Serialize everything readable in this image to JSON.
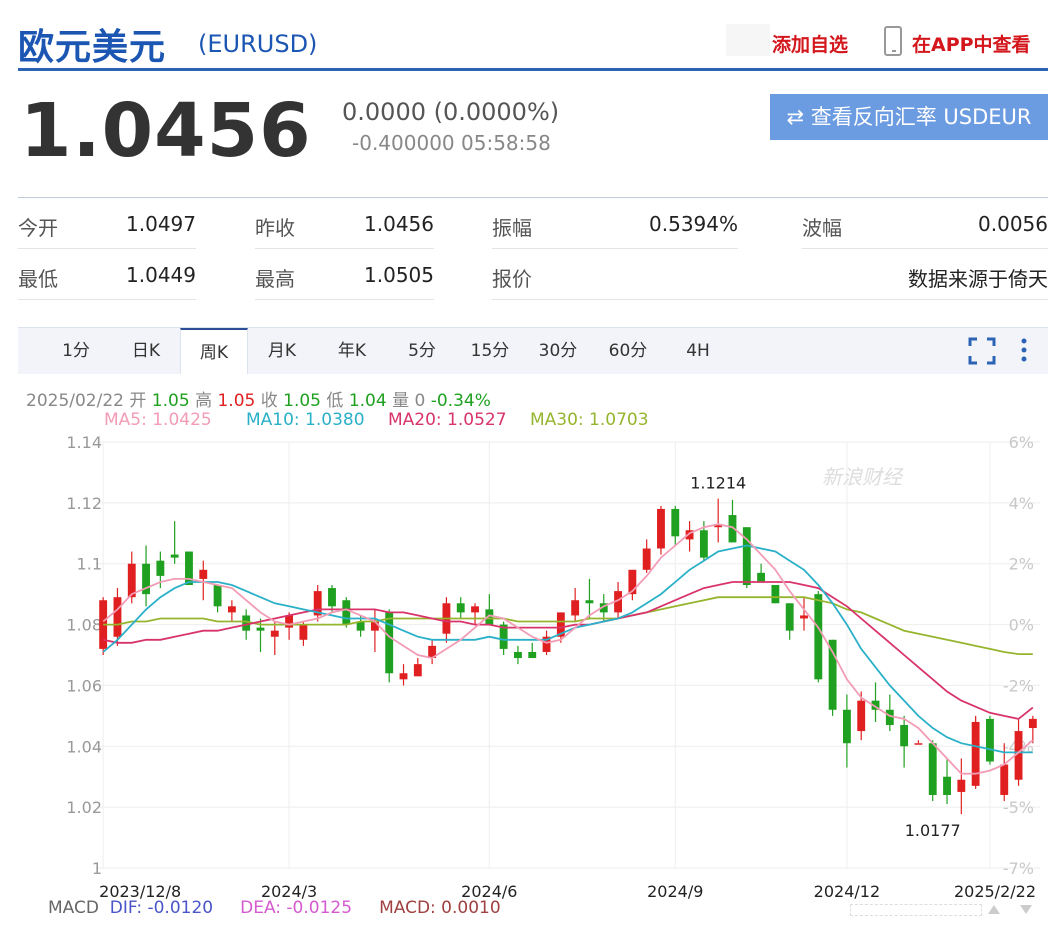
{
  "header": {
    "title": "欧元美元",
    "code": "(EURUSD)",
    "add_watchlist": "添加自选",
    "view_in_app": "在APP中查看"
  },
  "quote": {
    "price": "1.0456",
    "change": "0.0000 (0.0000%)",
    "sub": "-0.400000 05:58:58",
    "reverse_button": "⇄ 查看反向汇率 USDEUR"
  },
  "stats": {
    "open_label": "今开",
    "open": "1.0497",
    "prev_label": "昨收",
    "prev": "1.0456",
    "amp_label": "振幅",
    "amp": "0.5394%",
    "wave_label": "波幅",
    "wave": "0.0056",
    "low_label": "最低",
    "low": "1.0449",
    "high_label": "最高",
    "high": "1.0505",
    "quote_label": "报价",
    "source": "数据来源于倚天"
  },
  "tabs": [
    "1分",
    "日K",
    "周K",
    "月K",
    "年K",
    "5分",
    "15分",
    "30分",
    "60分",
    "4H"
  ],
  "active_tab": "周K",
  "info": {
    "date": "2025/02/22",
    "open_label": "开",
    "open": "1.05",
    "high_label": "高",
    "high": "1.05",
    "close_label": "收",
    "close": "1.05",
    "low_label": "低",
    "low": "1.04",
    "vol_label": "量",
    "vol": "0",
    "pct": "-0.34%",
    "ma5": "MA5: 1.0425",
    "ma10": "MA10: 1.0380",
    "ma20": "MA20: 1.0527",
    "ma30": "MA30: 1.0703"
  },
  "macd": {
    "label": "MACD",
    "dif": "DIF: -0.0120",
    "dea": "DEA: -0.0125",
    "macd": "MACD: 0.0010"
  },
  "watermark": "新浪财经",
  "colors": {
    "up": "#e02020",
    "down": "#20a020",
    "ma5": "#f29cb5",
    "ma10": "#2ab0c8",
    "ma20": "#d8336a",
    "ma30": "#96b52e",
    "brand": "#1b56b3",
    "accent_red": "#d4171d"
  },
  "chart_data": {
    "type": "candlestick",
    "y_ticks": [
      "1.14",
      "1.12",
      "1.1",
      "1.08",
      "1.06",
      "1.04",
      "1.02",
      "1"
    ],
    "y_values": [
      1.14,
      1.12,
      1.1,
      1.08,
      1.06,
      1.04,
      1.02,
      1.0
    ],
    "pct_ticks": [
      "6%",
      "4%",
      "2%",
      "0%",
      "-2%",
      "-4%",
      "-5%",
      "-7%"
    ],
    "x_labels": [
      "2023/12/8",
      "2024/3",
      "2024/6",
      "2024/9",
      "2024/12",
      "2025/2/22"
    ],
    "x_label_index": [
      0,
      13,
      27,
      40,
      52,
      62
    ],
    "ylim": [
      1.0,
      1.14
    ],
    "annotations": [
      {
        "label": "1.1214",
        "index": 43,
        "value": 1.1214
      },
      {
        "label": "1.0177",
        "index": 58,
        "value": 1.0177
      }
    ],
    "candles": [
      {
        "o": 1.072,
        "h": 1.089,
        "l": 1.07,
        "c": 1.088
      },
      {
        "o": 1.076,
        "h": 1.092,
        "l": 1.073,
        "c": 1.089
      },
      {
        "o": 1.089,
        "h": 1.104,
        "l": 1.087,
        "c": 1.1
      },
      {
        "o": 1.1,
        "h": 1.106,
        "l": 1.086,
        "c": 1.09
      },
      {
        "o": 1.101,
        "h": 1.104,
        "l": 1.092,
        "c": 1.096
      },
      {
        "o": 1.103,
        "h": 1.114,
        "l": 1.1,
        "c": 1.102
      },
      {
        "o": 1.104,
        "h": 1.104,
        "l": 1.093,
        "c": 1.093
      },
      {
        "o": 1.095,
        "h": 1.101,
        "l": 1.088,
        "c": 1.098
      },
      {
        "o": 1.093,
        "h": 1.093,
        "l": 1.084,
        "c": 1.086
      },
      {
        "o": 1.084,
        "h": 1.088,
        "l": 1.081,
        "c": 1.086
      },
      {
        "o": 1.083,
        "h": 1.085,
        "l": 1.075,
        "c": 1.078
      },
      {
        "o": 1.079,
        "h": 1.082,
        "l": 1.071,
        "c": 1.078
      },
      {
        "o": 1.076,
        "h": 1.081,
        "l": 1.07,
        "c": 1.078
      },
      {
        "o": 1.079,
        "h": 1.084,
        "l": 1.075,
        "c": 1.083
      },
      {
        "o": 1.075,
        "h": 1.081,
        "l": 1.073,
        "c": 1.08
      },
      {
        "o": 1.083,
        "h": 1.093,
        "l": 1.081,
        "c": 1.091
      },
      {
        "o": 1.092,
        "h": 1.093,
        "l": 1.084,
        "c": 1.086
      },
      {
        "o": 1.088,
        "h": 1.089,
        "l": 1.079,
        "c": 1.08
      },
      {
        "o": 1.081,
        "h": 1.083,
        "l": 1.076,
        "c": 1.078
      },
      {
        "o": 1.078,
        "h": 1.085,
        "l": 1.071,
        "c": 1.081
      },
      {
        "o": 1.084,
        "h": 1.085,
        "l": 1.061,
        "c": 1.064
      },
      {
        "o": 1.062,
        "h": 1.067,
        "l": 1.06,
        "c": 1.064
      },
      {
        "o": 1.063,
        "h": 1.069,
        "l": 1.063,
        "c": 1.067
      },
      {
        "o": 1.069,
        "h": 1.075,
        "l": 1.067,
        "c": 1.073
      },
      {
        "o": 1.077,
        "h": 1.089,
        "l": 1.074,
        "c": 1.087
      },
      {
        "o": 1.087,
        "h": 1.089,
        "l": 1.082,
        "c": 1.084
      },
      {
        "o": 1.084,
        "h": 1.087,
        "l": 1.08,
        "c": 1.086
      },
      {
        "o": 1.085,
        "h": 1.09,
        "l": 1.082,
        "c": 1.08
      },
      {
        "o": 1.08,
        "h": 1.081,
        "l": 1.07,
        "c": 1.072
      },
      {
        "o": 1.071,
        "h": 1.073,
        "l": 1.067,
        "c": 1.069
      },
      {
        "o": 1.071,
        "h": 1.074,
        "l": 1.069,
        "c": 1.069
      },
      {
        "o": 1.071,
        "h": 1.078,
        "l": 1.07,
        "c": 1.076
      },
      {
        "o": 1.076,
        "h": 1.081,
        "l": 1.074,
        "c": 1.084
      },
      {
        "o": 1.083,
        "h": 1.092,
        "l": 1.081,
        "c": 1.088
      },
      {
        "o": 1.088,
        "h": 1.095,
        "l": 1.082,
        "c": 1.087
      },
      {
        "o": 1.087,
        "h": 1.09,
        "l": 1.081,
        "c": 1.084
      },
      {
        "o": 1.084,
        "h": 1.094,
        "l": 1.082,
        "c": 1.091
      },
      {
        "o": 1.09,
        "h": 1.098,
        "l": 1.088,
        "c": 1.098
      },
      {
        "o": 1.098,
        "h": 1.108,
        "l": 1.097,
        "c": 1.105
      },
      {
        "o": 1.105,
        "h": 1.119,
        "l": 1.103,
        "c": 1.118
      },
      {
        "o": 1.118,
        "h": 1.119,
        "l": 1.106,
        "c": 1.109
      },
      {
        "o": 1.108,
        "h": 1.114,
        "l": 1.104,
        "c": 1.111
      },
      {
        "o": 1.111,
        "h": 1.114,
        "l": 1.101,
        "c": 1.102
      },
      {
        "o": 1.112,
        "h": 1.1214,
        "l": 1.107,
        "c": 1.113
      },
      {
        "o": 1.116,
        "h": 1.121,
        "l": 1.107,
        "c": 1.107
      },
      {
        "o": 1.112,
        "h": 1.112,
        "l": 1.092,
        "c": 1.093
      },
      {
        "o": 1.097,
        "h": 1.1,
        "l": 1.094,
        "c": 1.094
      },
      {
        "o": 1.093,
        "h": 1.093,
        "l": 1.087,
        "c": 1.087
      },
      {
        "o": 1.087,
        "h": 1.087,
        "l": 1.075,
        "c": 1.078
      },
      {
        "o": 1.082,
        "h": 1.089,
        "l": 1.078,
        "c": 1.083
      },
      {
        "o": 1.09,
        "h": 1.091,
        "l": 1.061,
        "c": 1.062
      },
      {
        "o": 1.075,
        "h": 1.075,
        "l": 1.05,
        "c": 1.052
      },
      {
        "o": 1.052,
        "h": 1.057,
        "l": 1.033,
        "c": 1.041
      },
      {
        "o": 1.045,
        "h": 1.058,
        "l": 1.042,
        "c": 1.055
      },
      {
        "o": 1.055,
        "h": 1.061,
        "l": 1.048,
        "c": 1.052
      },
      {
        "o": 1.052,
        "h": 1.057,
        "l": 1.045,
        "c": 1.047
      },
      {
        "o": 1.047,
        "h": 1.05,
        "l": 1.033,
        "c": 1.04
      },
      {
        "o": 1.041,
        "h": 1.042,
        "l": 1.041,
        "c": 1.041
      },
      {
        "o": 1.041,
        "h": 1.042,
        "l": 1.022,
        "c": 1.024
      },
      {
        "o": 1.03,
        "h": 1.036,
        "l": 1.021,
        "c": 1.024
      },
      {
        "o": 1.025,
        "h": 1.036,
        "l": 1.0177,
        "c": 1.029
      },
      {
        "o": 1.027,
        "h": 1.05,
        "l": 1.026,
        "c": 1.048
      },
      {
        "o": 1.049,
        "h": 1.05,
        "l": 1.034,
        "c": 1.035
      },
      {
        "o": 1.024,
        "h": 1.041,
        "l": 1.022,
        "c": 1.034
      },
      {
        "o": 1.029,
        "h": 1.049,
        "l": 1.027,
        "c": 1.045
      },
      {
        "o": 1.046,
        "h": 1.05,
        "l": 1.041,
        "c": 1.049
      }
    ],
    "ma5": [
      1.081,
      1.085,
      1.09,
      1.092,
      1.094,
      1.095,
      1.095,
      1.094,
      1.093,
      1.092,
      1.088,
      1.084,
      1.081,
      1.08,
      1.081,
      1.082,
      1.084,
      1.085,
      1.083,
      1.081,
      1.076,
      1.073,
      1.07,
      1.069,
      1.072,
      1.075,
      1.079,
      1.083,
      1.082,
      1.079,
      1.076,
      1.074,
      1.075,
      1.079,
      1.083,
      1.086,
      1.088,
      1.091,
      1.096,
      1.102,
      1.106,
      1.11,
      1.112,
      1.113,
      1.112,
      1.108,
      1.103,
      1.098,
      1.091,
      1.085,
      1.079,
      1.071,
      1.062,
      1.056,
      1.053,
      1.05,
      1.049,
      1.046,
      1.041,
      1.036,
      1.031,
      1.031,
      1.032,
      1.034,
      1.038,
      1.042
    ],
    "ma10": [
      1.071,
      1.075,
      1.08,
      1.085,
      1.089,
      1.092,
      1.094,
      1.094,
      1.094,
      1.093,
      1.091,
      1.089,
      1.087,
      1.086,
      1.085,
      1.084,
      1.083,
      1.082,
      1.082,
      1.082,
      1.08,
      1.078,
      1.076,
      1.075,
      1.075,
      1.075,
      1.075,
      1.076,
      1.075,
      1.075,
      1.075,
      1.075,
      1.077,
      1.079,
      1.08,
      1.081,
      1.082,
      1.084,
      1.087,
      1.09,
      1.094,
      1.098,
      1.101,
      1.104,
      1.105,
      1.106,
      1.105,
      1.104,
      1.101,
      1.098,
      1.093,
      1.087,
      1.08,
      1.072,
      1.066,
      1.06,
      1.055,
      1.05,
      1.046,
      1.043,
      1.041,
      1.04,
      1.039,
      1.038,
      1.038,
      1.038
    ],
    "ma20": [
      1.075,
      1.074,
      1.074,
      1.075,
      1.075,
      1.076,
      1.077,
      1.078,
      1.078,
      1.079,
      1.08,
      1.081,
      1.082,
      1.083,
      1.084,
      1.085,
      1.085,
      1.085,
      1.085,
      1.085,
      1.084,
      1.084,
      1.083,
      1.082,
      1.081,
      1.081,
      1.08,
      1.08,
      1.079,
      1.079,
      1.079,
      1.079,
      1.079,
      1.08,
      1.08,
      1.081,
      1.082,
      1.083,
      1.084,
      1.086,
      1.088,
      1.09,
      1.092,
      1.093,
      1.094,
      1.094,
      1.094,
      1.094,
      1.094,
      1.093,
      1.092,
      1.089,
      1.086,
      1.082,
      1.078,
      1.074,
      1.07,
      1.066,
      1.062,
      1.058,
      1.055,
      1.053,
      1.051,
      1.05,
      1.049,
      1.0527
    ],
    "ma30": [
      1.08,
      1.08,
      1.081,
      1.081,
      1.082,
      1.082,
      1.082,
      1.082,
      1.081,
      1.081,
      1.081,
      1.08,
      1.08,
      1.08,
      1.08,
      1.08,
      1.08,
      1.08,
      1.081,
      1.081,
      1.082,
      1.082,
      1.082,
      1.082,
      1.082,
      1.082,
      1.082,
      1.082,
      1.082,
      1.081,
      1.081,
      1.081,
      1.081,
      1.081,
      1.082,
      1.082,
      1.082,
      1.083,
      1.084,
      1.085,
      1.086,
      1.087,
      1.088,
      1.089,
      1.089,
      1.089,
      1.089,
      1.089,
      1.089,
      1.089,
      1.088,
      1.087,
      1.085,
      1.084,
      1.082,
      1.08,
      1.078,
      1.077,
      1.076,
      1.075,
      1.074,
      1.073,
      1.072,
      1.071,
      1.0703,
      1.0703
    ]
  }
}
